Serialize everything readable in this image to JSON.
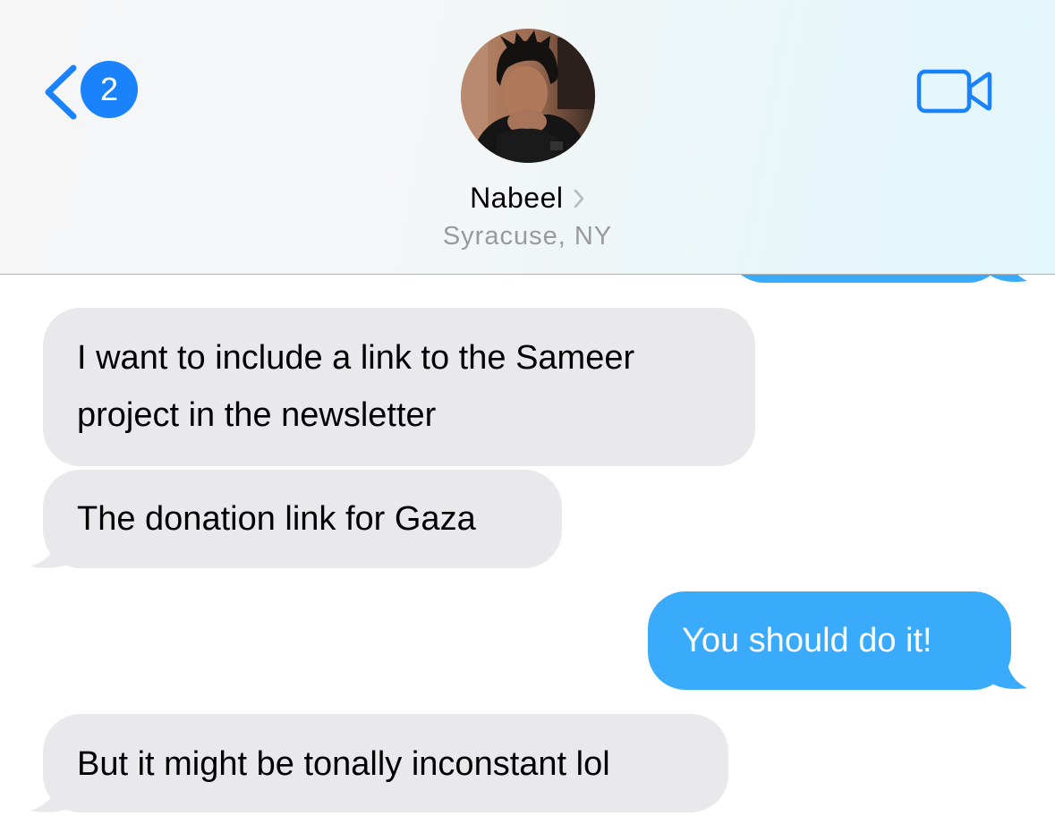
{
  "header": {
    "back_badge_count": "2",
    "contact_name": "Nabeel",
    "contact_location": "Syracuse, NY"
  },
  "messages": [
    {
      "direction": "outgoing",
      "text": ""
    },
    {
      "direction": "incoming",
      "line1": "I want to include a link to the Sameer",
      "line2": "project in the newsletter"
    },
    {
      "direction": "incoming",
      "text": "The donation link for Gaza"
    },
    {
      "direction": "outgoing",
      "text": "You should do it!"
    },
    {
      "direction": "incoming",
      "text": "But it might be tonally inconstant lol"
    }
  ],
  "colors": {
    "accent": "#1a82fb",
    "incoming_bubble": "#e9e9eb",
    "outgoing_bubble": "#3aabfb"
  },
  "icons": {
    "back": "chevron-left-icon",
    "facetime": "video-camera-icon",
    "name_disclosure": "chevron-right-icon"
  }
}
